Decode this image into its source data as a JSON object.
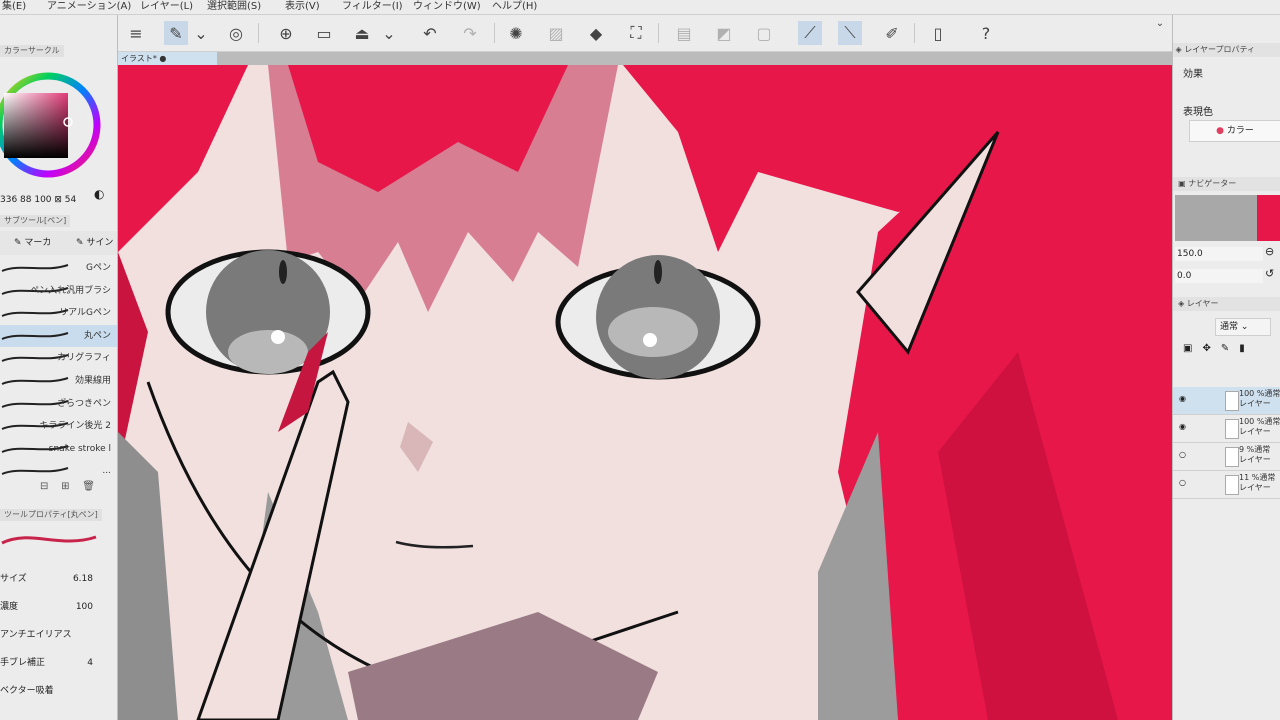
{
  "menu": [
    "集(E)",
    "アニメーション(A)",
    "レイヤー(L)",
    "選択範囲(S)",
    "表示(V)",
    "フィルター(I)",
    "ウィンドウ(W)",
    "ヘルプ(H)"
  ],
  "doc_tab": "イラスト*",
  "left": {
    "color_circle_title": "カラーサークル",
    "hsv_readout": "336 88 100",
    "hsv_extra": "54",
    "subtool_title": "サブツール[ペン]",
    "subtool_tabs": [
      "マーカ",
      "サイン"
    ],
    "brushes": [
      "Gペン",
      "ペン入れ汎用ブラシ",
      "リアルGペン",
      "丸ペン",
      "カリグラフィ",
      "効果線用",
      "ざらつきペン",
      "キラライン後光 2",
      "snake stroke l",
      "..."
    ],
    "selected_brush_index": 3,
    "tool_prop_title": "ツールプロパティ[丸ペン]",
    "props": [
      {
        "label": "サイズ",
        "value": "6.18"
      },
      {
        "label": "濃度",
        "value": "100"
      },
      {
        "label": "アンチエイリアス",
        "value": ""
      },
      {
        "label": "手ブレ補正",
        "value": "4"
      },
      {
        "label": "ベクター吸着",
        "value": ""
      }
    ]
  },
  "right": {
    "layer_prop_title": "レイヤープロパティ",
    "effect_label": "効果",
    "expression_color_label": "表現色",
    "color_mode": "カラー",
    "navigator_title": "ナビゲーター",
    "zoom": "150.0",
    "rotation": "0.0",
    "layer_title": "レイヤー",
    "blend_mode": "通常",
    "layers": [
      {
        "line1": "100 %通常",
        "line2": "レイヤー",
        "visible": true
      },
      {
        "line1": "100 %通常",
        "line2": "レイヤー",
        "visible": true
      },
      {
        "line1": "9 %通常",
        "line2": "レイヤー",
        "visible": false
      },
      {
        "line1": "11 %通常",
        "line2": "レイヤー",
        "visible": false
      }
    ]
  },
  "colors": {
    "accent": "#4a7fb5",
    "hair": "#e8174a",
    "skin": "#f2e0df",
    "selected_color": "#e23b78"
  },
  "icons": [
    "menu-icon",
    "pen-tool-icon",
    "chevron-down-icon",
    "lasso-icon",
    "new-file-icon",
    "open-folder-icon",
    "save-icon",
    "undo-icon",
    "redo-icon",
    "loading-icon",
    "fill-icon",
    "transform-icon",
    "ruler-icon",
    "eye-icon"
  ]
}
